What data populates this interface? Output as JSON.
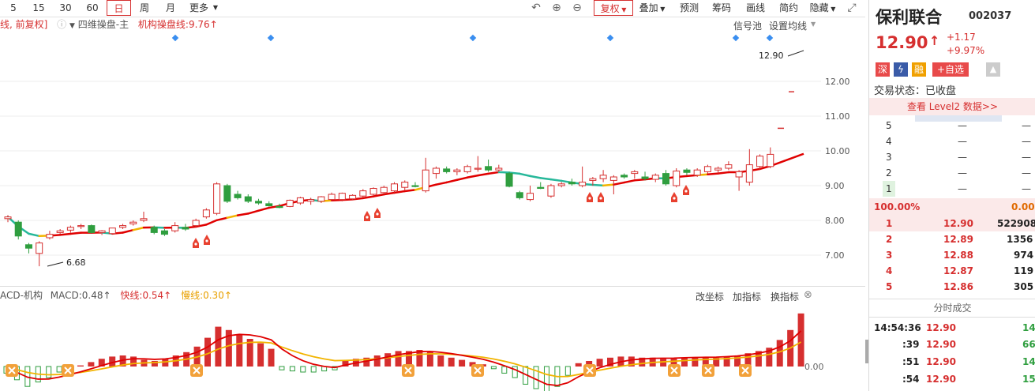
{
  "toolbar": {
    "periods": [
      "5",
      "15",
      "30",
      "60",
      "日",
      "周",
      "月",
      "更多"
    ],
    "active_period": "日",
    "right_buttons": [
      "复权",
      "叠加",
      "预测",
      "筹码",
      "画线",
      "简约",
      "隐藏"
    ]
  },
  "main_pane": {
    "legend_prefix": "线, 前复权]",
    "indicator_name": "四维操盘-主",
    "inst_line_label": "机构操盘线:9.76",
    "signal_pool": "信号池",
    "set_ma": "设置均线",
    "high_label": "12.90",
    "low_label": "6.68",
    "price_ticks": [
      "12.00",
      "11.00",
      "10.00",
      "9.00",
      "8.00",
      "7.00"
    ]
  },
  "macd_pane": {
    "name": "ACD-机构",
    "macd": "MACD:0.48",
    "fast": "快线:0.54",
    "slow": "慢线:0.30",
    "links": [
      "改坐标",
      "加指标",
      "换指标"
    ],
    "zero_tick": "0.00"
  },
  "stock": {
    "name": "保利联合",
    "code": "002037",
    "price": "12.90",
    "change": "+1.17",
    "change_pct": "+9.97%",
    "badges": [
      "深",
      "融",
      "+自选"
    ],
    "trade_status": "交易状态：已收盘",
    "level2": "查看 Level2 数据>>"
  },
  "sell_levels": [
    {
      "n": "5",
      "p": "—",
      "v": "—"
    },
    {
      "n": "4",
      "p": "—",
      "v": "—"
    },
    {
      "n": "3",
      "p": "—",
      "v": "—"
    },
    {
      "n": "2",
      "p": "—",
      "v": "—"
    },
    {
      "n": "1",
      "p": "—",
      "v": "—"
    }
  ],
  "ratio_left": "100.00%",
  "ratio_right": "0.00%",
  "buy_levels": [
    {
      "n": "1",
      "p": "12.90",
      "v": "522908"
    },
    {
      "n": "2",
      "p": "12.89",
      "v": "1356"
    },
    {
      "n": "3",
      "p": "12.88",
      "v": "974"
    },
    {
      "n": "4",
      "p": "12.87",
      "v": "119"
    },
    {
      "n": "5",
      "p": "12.86",
      "v": "305"
    }
  ],
  "trades_title": "分时成交",
  "trades": [
    {
      "t": "14:54:36",
      "p": "12.90",
      "v": "14"
    },
    {
      "t": ":39",
      "p": "12.90",
      "v": "66"
    },
    {
      "t": ":51",
      "p": "12.90",
      "v": "14"
    },
    {
      "t": ":54",
      "p": "12.90",
      "v": "15"
    }
  ],
  "colors": {
    "up": "#d62f2f",
    "down": "#2f9e3f",
    "accent_line": "#e00000",
    "ma_yellow": "#f2b400",
    "ma_teal": "#27b89a"
  },
  "candles": [
    {
      "o": 8.05,
      "h": 8.15,
      "l": 7.95,
      "c": 8.1
    },
    {
      "o": 7.95,
      "h": 8.0,
      "l": 7.45,
      "c": 7.55
    },
    {
      "o": 7.3,
      "h": 7.35,
      "l": 7.05,
      "c": 7.2
    },
    {
      "o": 7.05,
      "h": 7.4,
      "l": 6.68,
      "c": 7.35
    },
    {
      "o": 7.5,
      "h": 7.7,
      "l": 7.45,
      "c": 7.6
    },
    {
      "o": 7.65,
      "h": 7.75,
      "l": 7.6,
      "c": 7.7
    },
    {
      "o": 7.72,
      "h": 7.85,
      "l": 7.65,
      "c": 7.8
    },
    {
      "o": 7.85,
      "h": 7.9,
      "l": 7.75,
      "c": 7.85
    },
    {
      "o": 7.85,
      "h": 7.88,
      "l": 7.62,
      "c": 7.65
    },
    {
      "o": 7.65,
      "h": 7.72,
      "l": 7.58,
      "c": 7.7
    },
    {
      "o": 7.62,
      "h": 7.78,
      "l": 7.6,
      "c": 7.78
    },
    {
      "o": 7.8,
      "h": 7.9,
      "l": 7.75,
      "c": 7.85
    },
    {
      "o": 7.9,
      "h": 8.0,
      "l": 7.85,
      "c": 7.95
    },
    {
      "o": 8.0,
      "h": 8.25,
      "l": 7.95,
      "c": 8.05
    },
    {
      "o": 7.8,
      "h": 7.85,
      "l": 7.6,
      "c": 7.65
    },
    {
      "o": 7.7,
      "h": 7.75,
      "l": 7.55,
      "c": 7.6
    },
    {
      "o": 7.7,
      "h": 7.95,
      "l": 7.65,
      "c": 7.85
    },
    {
      "o": 7.8,
      "h": 7.9,
      "l": 7.7,
      "c": 7.75
    },
    {
      "o": 7.85,
      "h": 8.05,
      "l": 7.8,
      "c": 8.0
    },
    {
      "o": 8.1,
      "h": 8.35,
      "l": 8.05,
      "c": 8.3
    },
    {
      "o": 8.2,
      "h": 9.1,
      "l": 8.15,
      "c": 9.05
    },
    {
      "o": 9.0,
      "h": 9.05,
      "l": 8.5,
      "c": 8.55
    },
    {
      "o": 8.75,
      "h": 8.85,
      "l": 8.6,
      "c": 8.65
    },
    {
      "o": 8.68,
      "h": 8.75,
      "l": 8.5,
      "c": 8.55
    },
    {
      "o": 8.55,
      "h": 8.62,
      "l": 8.45,
      "c": 8.5
    },
    {
      "o": 8.48,
      "h": 8.55,
      "l": 8.4,
      "c": 8.42
    },
    {
      "o": 8.4,
      "h": 8.48,
      "l": 8.35,
      "c": 8.37
    },
    {
      "o": 8.4,
      "h": 8.6,
      "l": 8.38,
      "c": 8.58
    },
    {
      "o": 8.5,
      "h": 8.68,
      "l": 8.45,
      "c": 8.65
    },
    {
      "o": 8.55,
      "h": 8.65,
      "l": 8.45,
      "c": 8.6
    },
    {
      "o": 8.55,
      "h": 8.7,
      "l": 8.5,
      "c": 8.68
    },
    {
      "o": 8.6,
      "h": 8.8,
      "l": 8.55,
      "c": 8.75
    },
    {
      "o": 8.6,
      "h": 8.8,
      "l": 8.55,
      "c": 8.78
    },
    {
      "o": 8.62,
      "h": 8.75,
      "l": 8.58,
      "c": 8.72
    },
    {
      "o": 8.7,
      "h": 8.9,
      "l": 8.65,
      "c": 8.85
    },
    {
      "o": 8.75,
      "h": 8.95,
      "l": 8.7,
      "c": 8.92
    },
    {
      "o": 8.8,
      "h": 9.0,
      "l": 8.75,
      "c": 8.95
    },
    {
      "o": 8.85,
      "h": 9.1,
      "l": 8.8,
      "c": 9.05
    },
    {
      "o": 8.95,
      "h": 9.15,
      "l": 8.85,
      "c": 9.1
    },
    {
      "o": 9.0,
      "h": 9.1,
      "l": 8.95,
      "c": 8.98
    },
    {
      "o": 8.85,
      "h": 9.8,
      "l": 8.8,
      "c": 9.45
    },
    {
      "o": 9.35,
      "h": 9.55,
      "l": 9.2,
      "c": 9.5
    },
    {
      "o": 9.48,
      "h": 9.55,
      "l": 9.35,
      "c": 9.4
    },
    {
      "o": 9.4,
      "h": 9.5,
      "l": 9.3,
      "c": 9.45
    },
    {
      "o": 9.4,
      "h": 9.6,
      "l": 9.35,
      "c": 9.55
    },
    {
      "o": 9.48,
      "h": 9.85,
      "l": 9.4,
      "c": 9.5
    },
    {
      "o": 9.55,
      "h": 9.75,
      "l": 9.4,
      "c": 9.45
    },
    {
      "o": 9.45,
      "h": 9.6,
      "l": 9.4,
      "c": 9.5
    },
    {
      "o": 9.35,
      "h": 9.4,
      "l": 8.95,
      "c": 8.98
    },
    {
      "o": 8.8,
      "h": 8.85,
      "l": 8.6,
      "c": 8.65
    },
    {
      "o": 8.6,
      "h": 9.0,
      "l": 8.55,
      "c": 8.78
    },
    {
      "o": 8.95,
      "h": 9.1,
      "l": 8.9,
      "c": 8.92
    },
    {
      "o": 8.7,
      "h": 9.05,
      "l": 8.65,
      "c": 9.0
    },
    {
      "o": 9.0,
      "h": 9.1,
      "l": 8.95,
      "c": 9.05
    },
    {
      "o": 9.1,
      "h": 9.2,
      "l": 9.0,
      "c": 9.05
    },
    {
      "o": 9.0,
      "h": 9.55,
      "l": 8.95,
      "c": 9.1
    },
    {
      "o": 9.15,
      "h": 9.25,
      "l": 9.0,
      "c": 9.2
    },
    {
      "o": 9.2,
      "h": 9.45,
      "l": 9.1,
      "c": 9.3
    },
    {
      "o": 9.15,
      "h": 9.3,
      "l": 8.75,
      "c": 9.25
    },
    {
      "o": 9.3,
      "h": 9.35,
      "l": 9.2,
      "c": 9.25
    },
    {
      "o": 9.35,
      "h": 9.45,
      "l": 9.2,
      "c": 9.4
    },
    {
      "o": 9.25,
      "h": 9.4,
      "l": 9.15,
      "c": 9.2
    },
    {
      "o": 9.18,
      "h": 9.35,
      "l": 9.1,
      "c": 9.3
    },
    {
      "o": 9.35,
      "h": 9.45,
      "l": 9.0,
      "c": 9.05
    },
    {
      "o": 9.0,
      "h": 9.5,
      "l": 8.95,
      "c": 9.42
    },
    {
      "o": 9.45,
      "h": 9.5,
      "l": 9.3,
      "c": 9.38
    },
    {
      "o": 9.3,
      "h": 9.5,
      "l": 9.25,
      "c": 9.45
    },
    {
      "o": 9.4,
      "h": 9.6,
      "l": 9.35,
      "c": 9.55
    },
    {
      "o": 9.45,
      "h": 9.55,
      "l": 9.35,
      "c": 9.5
    },
    {
      "o": 9.5,
      "h": 9.7,
      "l": 9.45,
      "c": 9.6
    },
    {
      "o": 9.25,
      "h": 9.45,
      "l": 8.85,
      "c": 9.4
    },
    {
      "o": 9.1,
      "h": 10.05,
      "l": 9.0,
      "c": 9.6
    },
    {
      "o": 9.55,
      "h": 9.9,
      "l": 9.45,
      "c": 9.85
    },
    {
      "o": 9.55,
      "h": 10.1,
      "l": 9.5,
      "c": 9.9
    }
  ],
  "macd_bars": [
    -0.06,
    -0.12,
    -0.18,
    -0.14,
    -0.1,
    -0.05,
    -0.02,
    0.01,
    0.04,
    0.07,
    0.09,
    0.1,
    0.09,
    0.06,
    0.05,
    0.07,
    0.1,
    0.13,
    0.18,
    0.26,
    0.36,
    0.33,
    0.29,
    0.25,
    0.21,
    0.16,
    -0.03,
    -0.04,
    -0.05,
    -0.05,
    -0.04,
    -0.03,
    0.06,
    0.07,
    0.08,
    0.1,
    0.12,
    0.14,
    0.14,
    0.15,
    0.13,
    0.1,
    0.08,
    0.06,
    0.04,
    0.02,
    -0.02,
    -0.06,
    -0.1,
    -0.16,
    -0.2,
    -0.24,
    -0.18,
    -0.08,
    0.03,
    0.05,
    0.07,
    0.08,
    0.09,
    0.09,
    0.08,
    0.08,
    0.07,
    0.07,
    0.08,
    0.08,
    0.08,
    0.08,
    0.09,
    0.1,
    0.12,
    0.14,
    0.17,
    0.24,
    0.33,
    0.48
  ]
}
